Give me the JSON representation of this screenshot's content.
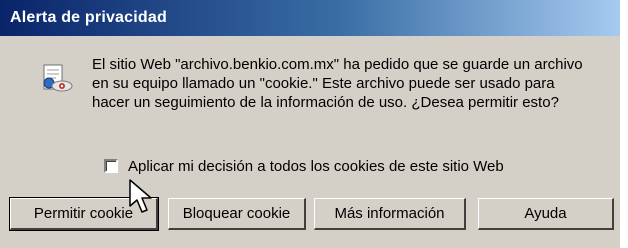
{
  "window": {
    "title": "Alerta de privacidad"
  },
  "message": {
    "icon": "privacy-cookie-icon",
    "text": "El sitio Web \"archivo.benkio.com.mx\" ha pedido que se guarde un archivo en su equipo llamado un \"cookie.\" Este archivo puede ser usado para hacer un seguimiento de la información de uso. ¿Desea permitir esto?"
  },
  "checkbox": {
    "label": "Aplicar mi decisión a todos los cookies de este sitio Web",
    "checked": false
  },
  "buttons": {
    "allow": "Permitir cookie",
    "block": "Bloquear cookie",
    "more_info": "Más información",
    "help": "Ayuda"
  }
}
